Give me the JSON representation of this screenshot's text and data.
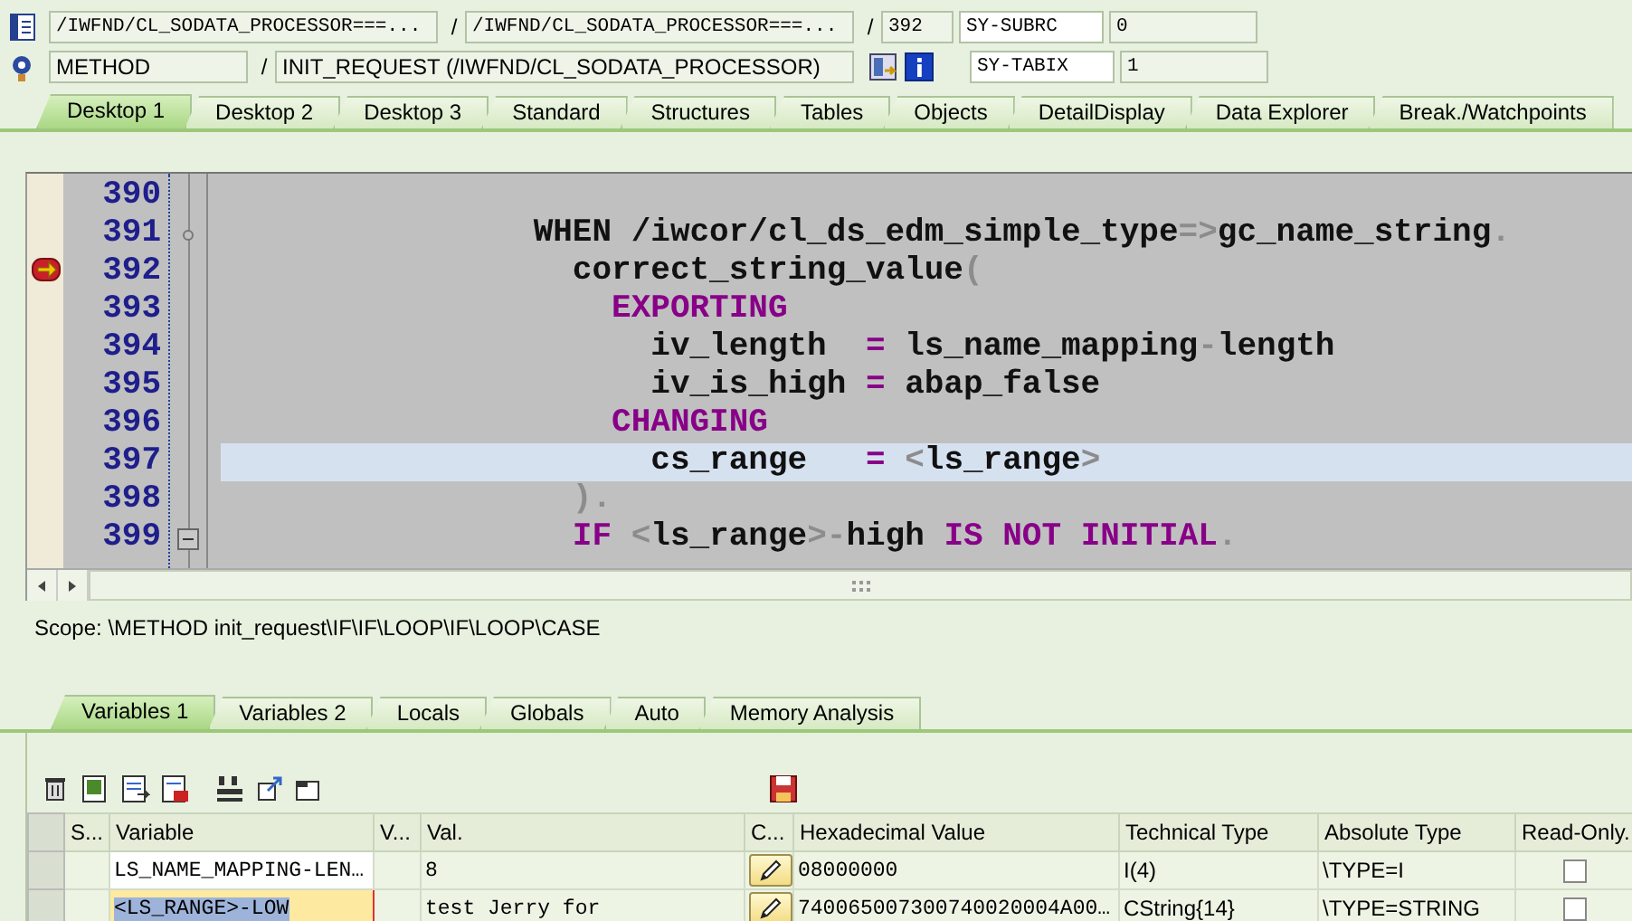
{
  "header": {
    "rows": [
      {
        "items": [
          {
            "kind": "field",
            "text": "/IWFND/CL_SODATA_PROCESSOR===..."
          },
          {
            "kind": "separator",
            "text": "/"
          },
          {
            "kind": "field",
            "text": "/IWFND/CL_SODATA_PROCESSOR===..."
          },
          {
            "kind": "separator",
            "text": "/"
          },
          {
            "kind": "field",
            "text": "392"
          },
          {
            "kind": "label",
            "text": "SY-SUBRC"
          },
          {
            "kind": "field",
            "text": "0"
          }
        ]
      },
      {
        "items": [
          {
            "kind": "field",
            "text": "METHOD"
          },
          {
            "kind": "separator",
            "text": "/"
          },
          {
            "kind": "field",
            "text": "INIT_REQUEST (/IWFND/CL_SODATA_PROCESSOR)"
          },
          {
            "kind": "tools"
          },
          {
            "kind": "label",
            "text": "SY-TABIX"
          },
          {
            "kind": "field",
            "text": "1"
          }
        ]
      }
    ]
  },
  "desktop_tabs": [
    {
      "label": "Desktop 1",
      "selected": true
    },
    {
      "label": "Desktop 2",
      "selected": false
    },
    {
      "label": "Desktop 3",
      "selected": false
    },
    {
      "label": "Standard",
      "selected": false
    },
    {
      "label": "Structures",
      "selected": false
    },
    {
      "label": "Tables",
      "selected": false
    },
    {
      "label": "Objects",
      "selected": false
    },
    {
      "label": "DetailDisplay",
      "selected": false
    },
    {
      "label": "Data Explorer",
      "selected": false
    },
    {
      "label": "Break./Watchpoints",
      "selected": false
    }
  ],
  "code": {
    "lines": [
      {
        "number": "390",
        "marker": false,
        "highlighted": false
      },
      {
        "number": "391",
        "marker": false,
        "highlighted": false,
        "kind": "node",
        "segments": [
          {
            "kind": "plain",
            "text": "                WHEN /iwcor/cl_ds_edm_simple_type"
          },
          {
            "kind": "punct",
            "text": "=>"
          },
          {
            "kind": "plain",
            "text": "gc_name_string"
          },
          {
            "kind": "punct",
            "text": "."
          }
        ]
      },
      {
        "number": "392",
        "marker": true,
        "highlighted": false,
        "segments": [
          {
            "kind": "plain",
            "text": "                  correct_string_value"
          },
          {
            "kind": "punct",
            "text": "("
          }
        ]
      },
      {
        "number": "393",
        "marker": false,
        "highlighted": false,
        "segments": [
          {
            "kind": "keyword",
            "text": "                    EXPORTING"
          }
        ]
      },
      {
        "number": "394",
        "marker": false,
        "highlighted": false,
        "segments": [
          {
            "kind": "plain",
            "text": "                      iv_length  "
          },
          {
            "kind": "keyword",
            "text": "="
          },
          {
            "kind": "plain",
            "text": " ls_name_mapping"
          },
          {
            "kind": "punct",
            "text": "-"
          },
          {
            "kind": "plain",
            "text": "length"
          }
        ]
      },
      {
        "number": "395",
        "marker": false,
        "highlighted": false,
        "segments": [
          {
            "kind": "plain",
            "text": "                      iv_is_high "
          },
          {
            "kind": "keyword",
            "text": "="
          },
          {
            "kind": "plain",
            "text": " abap_false"
          }
        ]
      },
      {
        "number": "396",
        "marker": false,
        "highlighted": false,
        "segments": [
          {
            "kind": "keyword",
            "text": "                    CHANGING"
          }
        ]
      },
      {
        "number": "397",
        "marker": false,
        "highlighted": true,
        "segments": [
          {
            "kind": "plain",
            "text": "                      cs_range   "
          },
          {
            "kind": "keyword",
            "text": "="
          },
          {
            "kind": "punct",
            "text": " <"
          },
          {
            "kind": "plain",
            "text": "ls_range"
          },
          {
            "kind": "punct",
            "text": ">"
          }
        ]
      },
      {
        "number": "398",
        "marker": false,
        "highlighted": false,
        "segments": [
          {
            "kind": "punct",
            "text": "                  )."
          }
        ]
      },
      {
        "number": "399",
        "marker": false,
        "highlighted": false,
        "kind": "block",
        "segments": [
          {
            "kind": "keyword",
            "text": "                  IF"
          },
          {
            "kind": "punct",
            "text": " <"
          },
          {
            "kind": "plain",
            "text": "ls_range"
          },
          {
            "kind": "punct",
            "text": ">-"
          },
          {
            "kind": "plain",
            "text": "high "
          },
          {
            "kind": "keyword",
            "text": "IS NOT INITIAL"
          },
          {
            "kind": "punct",
            "text": "."
          }
        ]
      }
    ]
  },
  "scope": "Scope: \\METHOD init_request\\IF\\IF\\LOOP\\IF\\LOOP\\CASE",
  "variable_tabs": [
    {
      "label": "Variables 1",
      "selected": true
    },
    {
      "label": "Variables 2",
      "selected": false
    },
    {
      "label": "Locals",
      "selected": false
    },
    {
      "label": "Globals",
      "selected": false
    },
    {
      "label": "Auto",
      "selected": false
    },
    {
      "label": "Memory Analysis",
      "selected": false
    }
  ],
  "table": {
    "columns": [
      "S...",
      "Variable",
      "V...",
      "Val.",
      "C...",
      "Hexadecimal Value",
      "Technical Type",
      "Absolute Type",
      "Read-Only."
    ],
    "rows": [
      {
        "selected": false,
        "variable": "LS_NAME_MAPPING-LEN…",
        "value": "8",
        "hex": "08000000",
        "technical_type": "I(4)",
        "absolute_type": "\\TYPE=I",
        "read_only": false
      },
      {
        "selected": true,
        "variable": "<LS_RANGE>-LOW",
        "value": "test Jerry for",
        "hex": "740065007300740020004A00…",
        "technical_type": "CString{14}",
        "absolute_type": "\\TYPE=STRING",
        "read_only": false
      }
    ]
  }
}
